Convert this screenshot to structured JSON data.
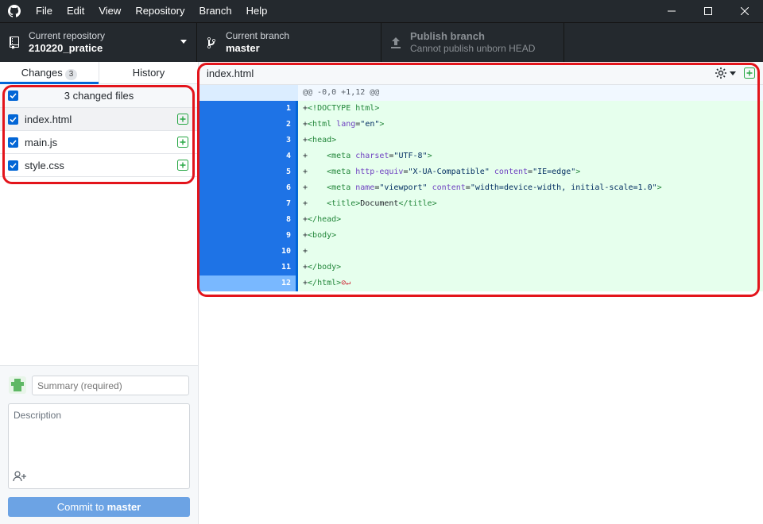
{
  "menu": [
    "File",
    "Edit",
    "View",
    "Repository",
    "Branch",
    "Help"
  ],
  "toolbar": {
    "repo_label": "Current repository",
    "repo_value": "210220_pratice",
    "branch_label": "Current branch",
    "branch_value": "master",
    "publish_label": "Publish branch",
    "publish_sub": "Cannot publish unborn HEAD"
  },
  "tabs": {
    "changes": "Changes",
    "changes_count": "3",
    "history": "History"
  },
  "files": {
    "header": "3 changed files",
    "items": [
      "index.html",
      "main.js",
      "style.css"
    ]
  },
  "commit": {
    "summary_placeholder": "Summary (required)",
    "description_placeholder": "Description",
    "button_prefix": "Commit to ",
    "button_branch": "master"
  },
  "diff": {
    "filename": "index.html",
    "hunk": "@@ -0,0 +1,12 @@",
    "line_numbers": [
      "1",
      "2",
      "3",
      "4",
      "5",
      "6",
      "7",
      "8",
      "9",
      "10",
      "11",
      "12"
    ]
  },
  "colors": {
    "accent": "#0366d6",
    "added_bg": "#e6ffed",
    "highlight": "#e3141b"
  }
}
